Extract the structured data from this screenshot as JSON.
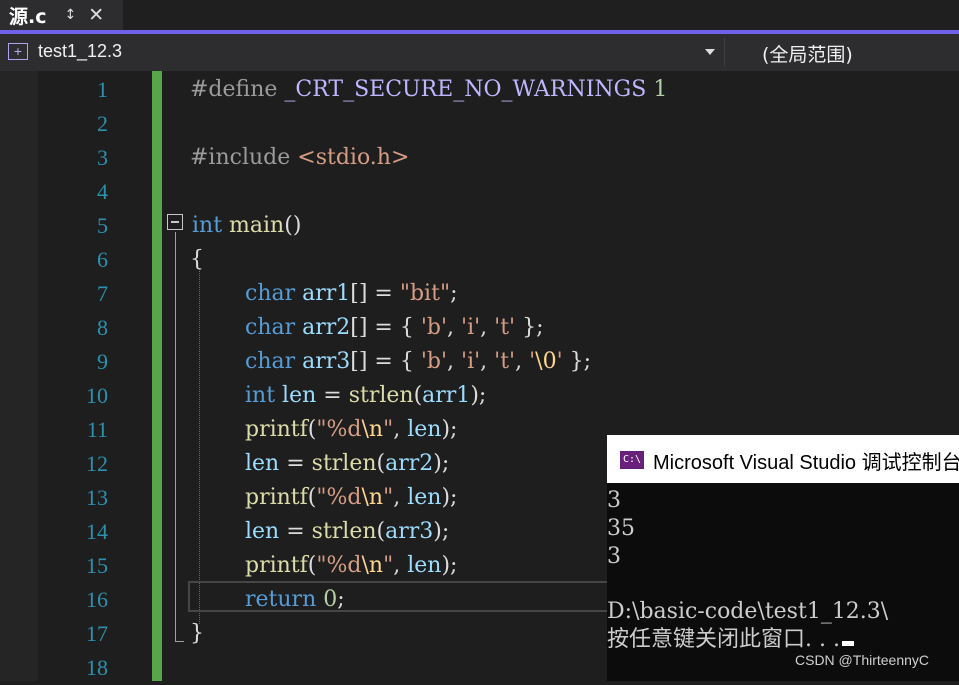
{
  "tab": {
    "title": "源.c",
    "pin_icon": "pin-icon",
    "close_icon": "close-icon"
  },
  "navbar": {
    "project": "test1_12.3",
    "scope": "(全局范围)"
  },
  "code": {
    "lines": [
      "1",
      "2",
      "3",
      "4",
      "5",
      "6",
      "7",
      "8",
      "9",
      "10",
      "11",
      "12",
      "13",
      "14",
      "15",
      "16",
      "17",
      "18"
    ],
    "l1": {
      "directive": "#define ",
      "macro": "_CRT_SECURE_NO_WARNINGS",
      "space": " ",
      "value": "1"
    },
    "l3": {
      "directive": "#include ",
      "header": "<stdio.h>"
    },
    "l5": {
      "type": "int",
      "space": " ",
      "func": "main",
      "parens": "()"
    },
    "l6": {
      "brace": "{"
    },
    "l7": {
      "type": "char",
      "name": " arr1",
      "rest": "[] = ",
      "str": "\"bit\"",
      "end": ";"
    },
    "l8": {
      "type": "char",
      "name": " arr2",
      "rest": "[] = { ",
      "c1": "'b'",
      "s1": ", ",
      "c2": "'i'",
      "s2": ", ",
      "c3": "'t'",
      "end": " };"
    },
    "l9": {
      "type": "char",
      "name": " arr3",
      "rest": "[] = { ",
      "c1": "'b'",
      "s1": ", ",
      "c2": "'i'",
      "s2": ", ",
      "c3": "'t'",
      "s3": ", ",
      "c4a": "'",
      "c4esc": "\\0",
      "c4b": "'",
      "end": " };"
    },
    "l10": {
      "type": "int",
      "name": " len",
      "op": " = ",
      "func": "strlen",
      "open": "(",
      "arg": "arr1",
      "end": ");"
    },
    "l11": {
      "func": "printf",
      "open": "(",
      "q1": "\"",
      "fmt": "%d",
      "esc": "\\n",
      "q2": "\"",
      "sep": ", ",
      "arg": "len",
      "end": ");"
    },
    "l12": {
      "name": "len",
      "op": " = ",
      "func": "strlen",
      "open": "(",
      "arg": "arr2",
      "end": ");"
    },
    "l13": {
      "func": "printf",
      "open": "(",
      "q1": "\"",
      "fmt": "%d",
      "esc": "\\n",
      "q2": "\"",
      "sep": ", ",
      "arg": "len",
      "end": ");"
    },
    "l14": {
      "name": "len",
      "op": " = ",
      "func": "strlen",
      "open": "(",
      "arg": "arr3",
      "end": ");"
    },
    "l15": {
      "func": "printf",
      "open": "(",
      "q1": "\"",
      "fmt": "%d",
      "esc": "\\n",
      "q2": "\"",
      "sep": ", ",
      "arg": "len",
      "end": ");"
    },
    "l16": {
      "kw": "return",
      "space": " ",
      "value": "0",
      "end": ";"
    },
    "l17": {
      "brace": "}"
    }
  },
  "console": {
    "icon_text": "C:\\",
    "title": "Microsoft Visual Studio 调试控制台",
    "out1": "3",
    "out2": "35",
    "out3": "3",
    "path": "D:\\basic-code\\test1_12.3\\",
    "prompt": "按任意键关闭此窗口. . ."
  },
  "watermark": "CSDN @ThirteennyC",
  "colors": {
    "accent": "#7160e8",
    "change_bar": "#57a64a",
    "keyword": "#569cd6",
    "string": "#d69d85",
    "line_number": "#2b91af"
  }
}
